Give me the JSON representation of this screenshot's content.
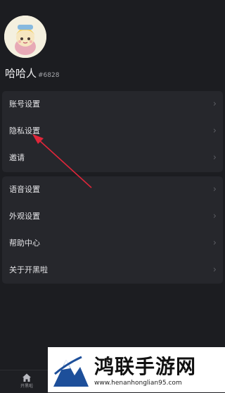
{
  "profile": {
    "username": "哈哈人",
    "tag": "#6828"
  },
  "groups": [
    {
      "items": [
        {
          "label": "账号设置"
        },
        {
          "label": "隐私设置"
        },
        {
          "label": "邀请"
        }
      ]
    },
    {
      "items": [
        {
          "label": "语音设置"
        },
        {
          "label": "外观设置"
        },
        {
          "label": "帮助中心"
        },
        {
          "label": "关于开黑啦"
        }
      ]
    }
  ],
  "tabbar": {
    "home_label": "开黑啦"
  },
  "watermark": {
    "title": "鸿联手游网",
    "url": "www.henanhonglian95.com"
  },
  "colors": {
    "background": "#1c1d21",
    "panel": "#26272c",
    "annotation_arrow": "#e0263a"
  },
  "icons": [
    "chevron-right-icon",
    "home-icon",
    "avatar-image",
    "watermark-logo"
  ]
}
